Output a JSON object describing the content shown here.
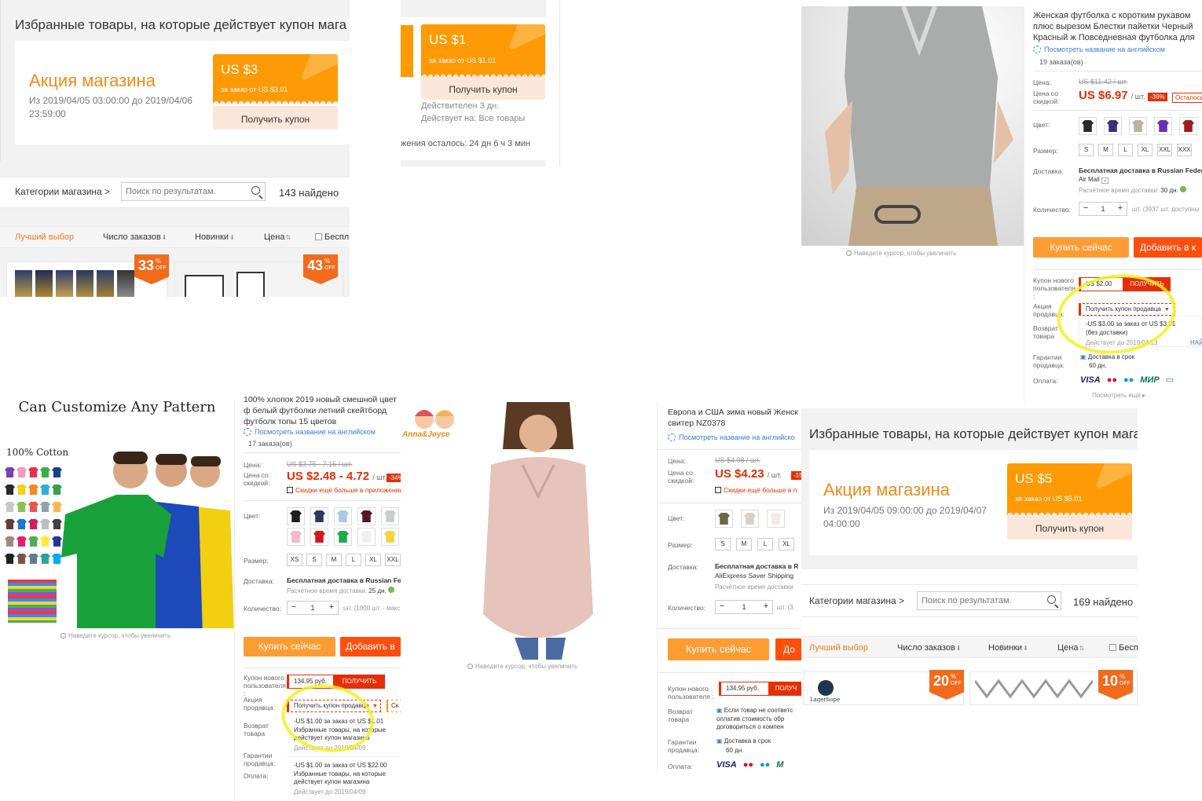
{
  "colors": {
    "accent_orange": "#fd9a05",
    "aliexpress_red": "#e62e04",
    "buy_button": "#fe9c34",
    "cart_button": "#fe4f0d",
    "highlight": "#f5f01a"
  },
  "store_promo_a": {
    "heading": "Избранные товары, на которые действует купон мага",
    "promo_title": "Акция магазина",
    "dates": "Из 2019/04/05 03:00:00 до 2019/04/06 23:59:00",
    "coupon_amount": "US $3",
    "coupon_min": "за заказ от US $3.01",
    "coupon_button": "Получить купон",
    "categories_label": "Категории магазина >",
    "search_placeholder": "Поиск по результатам.",
    "found": "143 найдено",
    "sort": [
      "Лучший выбор",
      "Число заказов",
      "Новинки",
      "Цена",
      "Беспл"
    ],
    "badges": [
      {
        "num": "33",
        "pct": "%",
        "off": "OFF"
      },
      {
        "num": "43",
        "pct": "%",
        "off": "OFF"
      }
    ]
  },
  "coupon_fragment": {
    "coupon_amount": "US $1",
    "coupon_min": "за заказ от US $1.01",
    "coupon_button": "Получить купон",
    "valid": "Действителен 3 дн.",
    "applies": "Действует на: Все товары",
    "remaining": "жения осталось: 24 дн 6 ч 3 мин"
  },
  "product_top": {
    "title": "Женская футболка с коротким рукавом плюс вырезом Блестки пайетки Черный Красный ж Повседневная футболка для женщин топы N",
    "english_link": "Посмотреть название на английском",
    "orders": "19 заказа(ов)",
    "price_label": "Цена:",
    "old_price": "US $11.42 / шт.",
    "discount_label": "Цена со скидкой:",
    "price": "US $6.97",
    "unit": "/ шт.",
    "discount_pct": "-39%",
    "tag": "Осталось",
    "color_label": "Цвет:",
    "swatch_colors": [
      "#2a2a2a",
      "#3b2f7a",
      "#b9b2ab",
      "#6a2fb0",
      "#9b1d1d"
    ],
    "size_label": "Размер:",
    "sizes": [
      "S",
      "M",
      "L",
      "XL",
      "XXL",
      "XXX"
    ],
    "shipping_label": "Доставка:",
    "shipping": "Бесплатная доставка в Russian Federa",
    "shipping_method": "Air Mail",
    "shipping_time": "Расчётное время доставки:",
    "shipping_days": "30 дн.",
    "qty_label": "Количество:",
    "qty": "1",
    "qty_note": "шт. (3937 шт. доступны",
    "buy": "Купить сейчас",
    "cart": "Добавить в к",
    "new_user_label": "Купон нового пользователя :",
    "new_user_amount": "US $2.00",
    "get": "ПОЛУЧИТЬ",
    "seller_label": "Акция продавца:",
    "seller_dd": "Получить купон продавца",
    "dd_text": "-US $3.00 за заказ от US $3.01 (без доставки)",
    "dd_valid": "Действует до 2019/04/13",
    "return_label": "Возврат товара",
    "guarantee_label": "Гарантии продавца:",
    "guarantee": "Доставка в срок",
    "guarantee_days": "60 дн.",
    "pay_label": "Оплата:",
    "pay": [
      "VISA",
      "●●",
      "●●",
      "МИР",
      "▭"
    ],
    "more": "Посмотреть ещё ▸",
    "zoom_hint": "Наведите курсор, чтобы увеличить",
    "side_link": "НАЙ"
  },
  "product_tshirt": {
    "image_caption": "Can Customize Any Pattern",
    "image_sub": "100% Cotton",
    "title": "100% хлопок 2019 новый смешной цвет ф белый футболки летний скейтборд футболк топы 15 цветов",
    "english_link": "Посмотреть название на английском",
    "orders": "17 заказа(ов)",
    "price_label": "Цена:",
    "old_price": "US $3.75 - 7.15 / шт.",
    "discount_label": "Цена со скидкой:",
    "price": "US $2.48 - 4.72",
    "unit": "/ шт.",
    "discount_pct": "-34%",
    "app_link": "Скидки ещё больше в приложении",
    "color_label": "Цвет:",
    "swatch_colors": [
      "#1e1e1e",
      "#2c3a5e",
      "#a9c8e8",
      "#5a1525",
      "#c9cccf",
      "#f4b8c8",
      "#d4161b",
      "#1faa4f",
      "#f0f0f0",
      "#f5d53a"
    ],
    "size_label": "Размер:",
    "sizes": [
      "XS",
      "S",
      "M",
      "L",
      "XL",
      "XXL"
    ],
    "shipping_label": "Доставка:",
    "shipping": "Бесплатная доставка в Russian Fede",
    "shipping_time": "Расчётное время доставки:",
    "shipping_days": "25 дн.",
    "qty_label": "Количество:",
    "qty": "1",
    "qty_note": "шт. (1000 шт. - макс",
    "buy": "Купить сейчас",
    "cart": "Добавить в",
    "new_user_label": "Купон нового пользователя :",
    "new_user_amount": "134,95 руб.",
    "get": "ПОЛУЧИТЬ",
    "seller_label": "Акция продавца:",
    "seller_dd": "Получить купон продавца",
    "seller_extra": "Ск",
    "dd_text": "-US $1.00 за заказ от US $1.01 Избранные товары, на которые действует купон магазина",
    "dd_valid": "Действует до 2019/04/09",
    "return_label": "Возврат товара",
    "guarantee_label": "Гарантии продавца:",
    "pay_label": "Оплата:",
    "dd_text2": "-US $1.00 за заказ от US $22.00 Избранные товары, на которые действует купон магазина",
    "dd_valid2": "Действует до 2019/04/09",
    "zoom_hint": "Наведите курсор, чтобы увеличить"
  },
  "product_sweater": {
    "brand": "Anna&Joyce",
    "title": "Европа и США зима новый Женск свитер NZ0378",
    "english_link": "Посмотреть название на английско",
    "price_label": "Цена:",
    "old_price": "US $4.98 / шт.",
    "discount_label": "Цена со скидкой:",
    "price": "US $4.23",
    "unit": "/ шт.",
    "discount_pct": "-15",
    "app_link": "Скидки ещё больше в п",
    "color_label": "Цвет:",
    "swatch_colors": [
      "#6b6a45",
      "#d9cfc7",
      "#f1ece8"
    ],
    "size_label": "Размер:",
    "sizes": [
      "S",
      "M",
      "L",
      "XL"
    ],
    "shipping_label": "Доставка:",
    "shipping": "Бесплатная доставка в R",
    "shipping_method": "AliExpress Saver Shipping",
    "shipping_time": "Расчётное время доставки",
    "qty_label": "Количество:",
    "qty": "1",
    "qty_note": "шт. (3",
    "buy": "Купить сейчас",
    "cart": "До",
    "new_user_label": "Купон нового пользователя :",
    "new_user_amount": "134,95 руб.",
    "get": "ПОЛУЧ",
    "return_label": "Возврат товара",
    "return_text": "Если товар не соответс оплатив стоимость обр договориться о компен",
    "guarantee_label": "Гарантии продавца:",
    "guarantee": "Доставка в срок",
    "guarantee_days": "60 дн.",
    "pay_label": "Оплата:",
    "pay": [
      "VISA",
      "●●",
      "●●",
      "M"
    ],
    "zoom_hint": "Наведите курсор, чтобы увеличить"
  },
  "store_promo_b": {
    "heading": "Избранные товары, на которые действует купон мага",
    "promo_title": "Акция магазина",
    "dates": "Из 2019/04/05 09:00:00 до 2019/04/07 04:00:00",
    "coupon_amount": "US $5",
    "coupon_min": "за заказ от US $5.01",
    "coupon_button": "Получить купон",
    "categories_label": "Категории магазина >",
    "search_placeholder": "Поиск по результатам.",
    "found": "169 найдено",
    "sort": [
      "Лучший выбор",
      "Число заказов",
      "Новинки",
      "Цена",
      "Бесп"
    ],
    "store_logo": "Lagerhope",
    "badges": [
      {
        "num": "20",
        "pct": "%",
        "off": "OFF"
      },
      {
        "num": "10",
        "pct": "%",
        "off": "OFF"
      }
    ]
  }
}
